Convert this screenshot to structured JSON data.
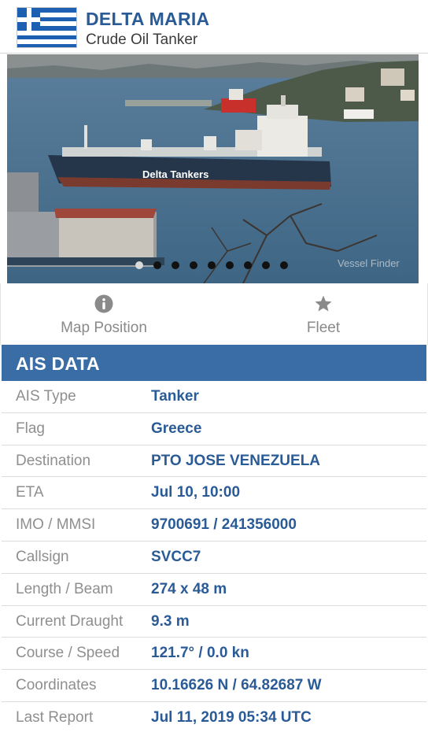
{
  "vessel": {
    "name": "DELTA MARIA",
    "type": "Crude Oil Tanker",
    "flag_country": "Greece"
  },
  "photo": {
    "slide_count": 9,
    "active_slide": 1,
    "hull_text": "Delta Tankers",
    "watermark": "Vessel Finder"
  },
  "actions": [
    {
      "label": "Map Position",
      "icon": "info-circle-icon"
    },
    {
      "label": "Fleet",
      "icon": "star-icon"
    }
  ],
  "ais": {
    "title": "AIS DATA",
    "rows": [
      {
        "key": "AIS Type",
        "value": "Tanker"
      },
      {
        "key": "Flag",
        "value": "Greece"
      },
      {
        "key": "Destination",
        "value": "PTO JOSE VENEZUELA"
      },
      {
        "key": "ETA",
        "value": "Jul 10, 10:00"
      },
      {
        "key": "IMO / MMSI",
        "value": "9700691 / 241356000"
      },
      {
        "key": "Callsign",
        "value": "SVCC7"
      },
      {
        "key": "Length / Beam",
        "value": "274 x 48 m"
      },
      {
        "key": "Current Draught",
        "value": "9.3 m"
      },
      {
        "key": "Course / Speed",
        "value": "121.7° / 0.0 kn"
      },
      {
        "key": "Coordinates",
        "value": "10.16626 N / 64.82687 W"
      },
      {
        "key": "Last Report",
        "value": "Jul 11, 2019 05:34 UTC"
      }
    ]
  },
  "colors": {
    "accent": "#3a6ca6",
    "value_text": "#2a5b96",
    "label_text": "#8f8f8f"
  }
}
